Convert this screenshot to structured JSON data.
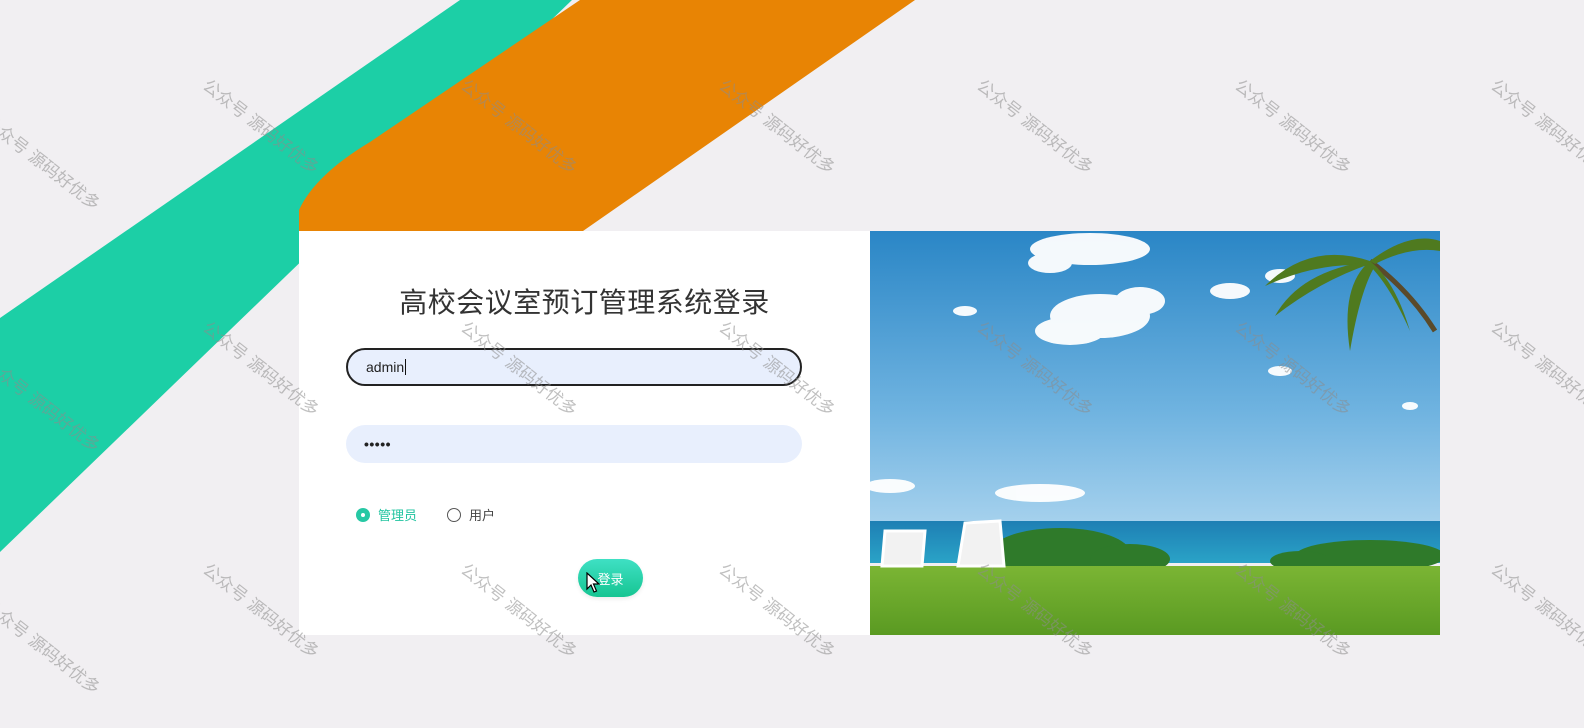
{
  "login": {
    "title": "高校会议室预订管理系统登录",
    "username_value": "admin",
    "password_masked": "•••••",
    "roles": [
      {
        "label": "管理员",
        "checked": true
      },
      {
        "label": "用户",
        "checked": false
      }
    ],
    "submit_label": "登录"
  },
  "watermark": "公众号 源码好优多",
  "colors": {
    "accent": "#26c8a4",
    "stripe_green": "#1ccfa6",
    "stripe_orange": "#e88404",
    "input_bg": "#e8effd"
  }
}
